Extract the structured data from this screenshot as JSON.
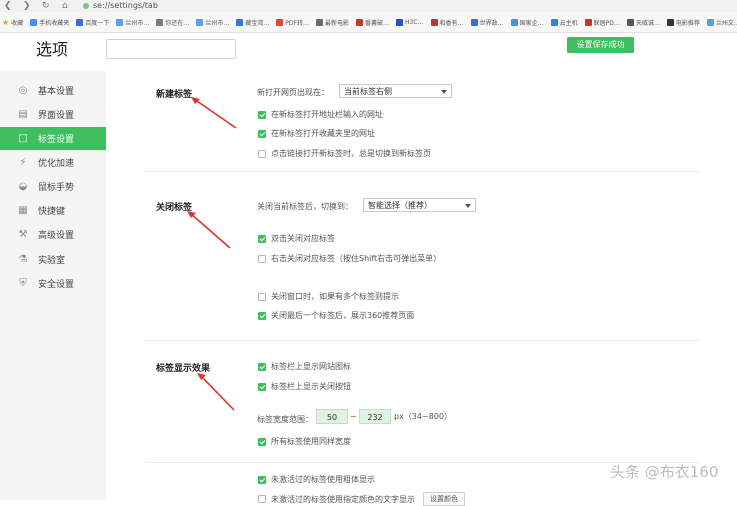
{
  "browser": {
    "url": "se://settings/tab",
    "bookmarks": [
      {
        "label": "收藏",
        "color": "#e6a700"
      },
      {
        "label": "手机收藏夹",
        "color": "#4c8df6"
      },
      {
        "label": "百度一下",
        "color": "#3a6fd8"
      },
      {
        "label": "兰州市…",
        "color": "#5aa0e6"
      },
      {
        "label": "你还在…",
        "color": "#7a7a7a"
      },
      {
        "label": "兰州市…",
        "color": "#5aa0e6"
      },
      {
        "label": "藏宝湾…",
        "color": "#2f7ad8"
      },
      {
        "label": "PDF转…",
        "color": "#d84a3a"
      },
      {
        "label": "最新电影",
        "color": "#6a6a6a"
      },
      {
        "label": "番薯破…",
        "color": "#c0392b"
      },
      {
        "label": "H3C…",
        "color": "#1f56c3"
      },
      {
        "label": "和香有…",
        "color": "#b03a3a"
      },
      {
        "label": "世界政…",
        "color": "#3a6fd8"
      },
      {
        "label": "国家企…",
        "color": "#4a90e2"
      },
      {
        "label": "云主机",
        "color": "#2a8ad8"
      },
      {
        "label": "联居PD…",
        "color": "#c0392b"
      },
      {
        "label": "天威诚…",
        "color": "#555555"
      },
      {
        "label": "电影推荐",
        "color": "#333333"
      },
      {
        "label": "兰州文…",
        "color": "#5aa0e6"
      }
    ]
  },
  "header": {
    "title": "选项",
    "search_placeholder": "",
    "saved_label": "设置保存成功"
  },
  "sidebar": {
    "items": [
      {
        "label": "基本设置",
        "icon": "settings-icon",
        "active": false
      },
      {
        "label": "界面设置",
        "icon": "layout-icon",
        "active": false
      },
      {
        "label": "标签设置",
        "icon": "tab-icon",
        "active": true
      },
      {
        "label": "优化加速",
        "icon": "lightning-icon",
        "active": false
      },
      {
        "label": "鼠标手势",
        "icon": "mouse-icon",
        "active": false
      },
      {
        "label": "快捷键",
        "icon": "keyboard-icon",
        "active": false
      },
      {
        "label": "高级设置",
        "icon": "wrench-icon",
        "active": false
      },
      {
        "label": "实验室",
        "icon": "flask-icon",
        "active": false
      },
      {
        "label": "安全设置",
        "icon": "shield-icon",
        "active": false
      }
    ]
  },
  "sections": {
    "new_tab": {
      "title": "新建标签",
      "open_position_label": "新打开网页出现在：",
      "open_position_value": "当前标签右侧",
      "options": [
        {
          "label": "在新标签打开地址栏输入的网址",
          "checked": true
        },
        {
          "label": "在新标签打开收藏夹里的网址",
          "checked": true
        },
        {
          "label": "点击链接打开新标签时，总是切换到新标签页",
          "checked": false
        }
      ]
    },
    "close_tab": {
      "title": "关闭标签",
      "switch_label": "关闭当前标签后，切换到：",
      "switch_value": "智能选择（推荐）",
      "options": [
        {
          "label": "双击关闭对应标签",
          "checked": true
        },
        {
          "label": "右击关闭对应标签（按住Shift右击可弹出菜单）",
          "checked": false
        },
        {
          "label": "关闭窗口时，如果有多个标签则提示",
          "checked": false
        },
        {
          "label": "关闭最后一个标签后，展示360推荐页面",
          "checked": true
        }
      ]
    },
    "display": {
      "title": "标签显示效果",
      "options": [
        {
          "label": "标签栏上显示网站图标",
          "checked": true
        },
        {
          "label": "标签栏上显示关闭按钮",
          "checked": true
        }
      ],
      "width_label": "标签宽度范围：",
      "width_min": "50",
      "width_sep": "~",
      "width_max": "232",
      "width_unit": "px（34~800）",
      "same_width_label": "所有标签使用同样宽度",
      "same_width_checked": true,
      "bold_label": "未激活过的标签使用粗体显示",
      "bold_checked": true,
      "color_label": "未激活过的标签使用指定颜色的文字显示",
      "color_checked": false,
      "color_button": "设置颜色"
    }
  },
  "watermark": "头条 @布衣160",
  "colors": {
    "accent": "#3fbf5f",
    "arrow": "#d9362b"
  }
}
